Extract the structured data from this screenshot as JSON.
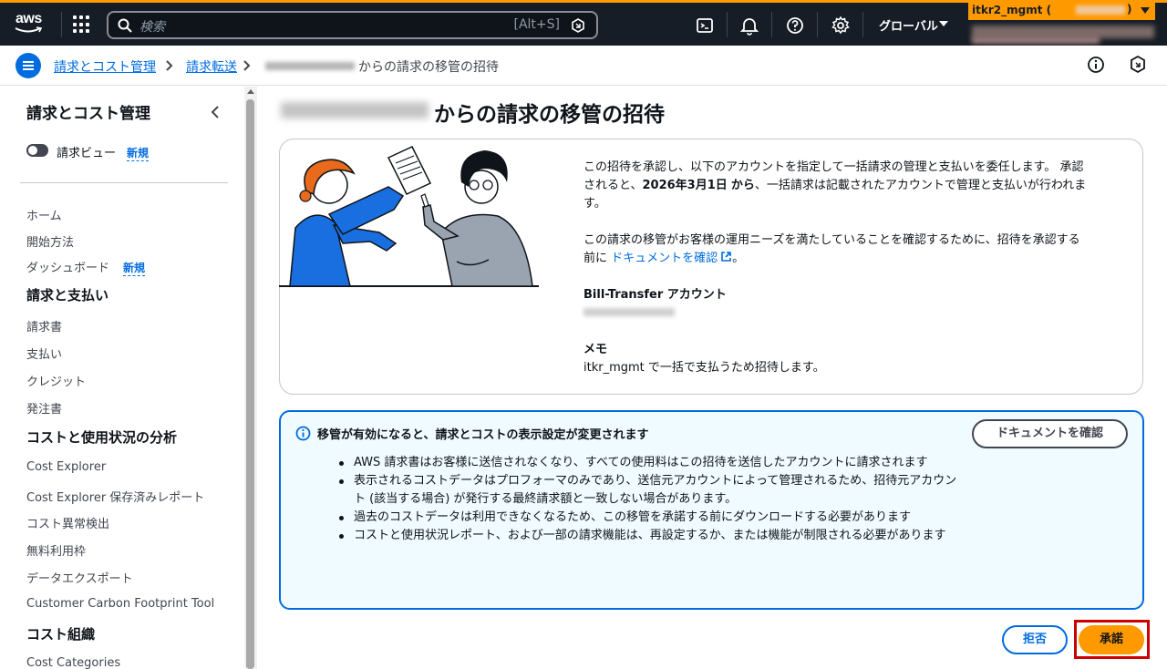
{
  "topbar": {
    "logo_text": "aws",
    "search_placeholder": "検索",
    "search_shortcut": "[Alt+S]",
    "region_label": "グローバル",
    "account_label": "itkr2_mgmt (",
    "account_close": ")"
  },
  "breadcrumb": {
    "items": [
      "請求とコスト管理",
      "請求転送"
    ],
    "current_suffix": "からの請求の移管の招待"
  },
  "sidebar": {
    "title": "請求とコスト管理",
    "billing_view_label": "請求ビュー",
    "new_badge": "新規",
    "items_top": [
      "ホーム",
      "開始方法",
      "ダッシュボード"
    ],
    "sections": [
      {
        "heading": "請求と支払い",
        "items": [
          "請求書",
          "支払い",
          "クレジット",
          "発注書"
        ]
      },
      {
        "heading": "コストと使用状況の分析",
        "items": [
          "Cost Explorer",
          "Cost Explorer 保存済みレポート",
          "コスト異常検出",
          "無料利用枠",
          "データエクスポート",
          "Customer Carbon Footprint Tool"
        ]
      },
      {
        "heading": "コスト組織",
        "items": [
          "Cost Categories"
        ]
      }
    ]
  },
  "main": {
    "title_suffix": "からの請求の移管の招待",
    "intro_line1": "この招待を承認し、以下のアカウントを指定して一括請求の管理と支払いを委任します。 承認",
    "intro_line2_pre": "されると、",
    "intro_date": "2026年3月1日",
    "intro_line2_mid": "から",
    "intro_line2_post": "、一括請求は記載されたアカウントで管理と支払いが行われま",
    "intro_line3": "す。",
    "confirm_line1": "この請求の移管がお客様の運用ニーズを満たしていることを確認するために、招待を承認する",
    "confirm_line2_pre": "前に",
    "confirm_link": "ドキュメントを確認",
    "confirm_line2_post": "。",
    "account_heading": "Bill-Transfer アカウント",
    "memo_heading": "メモ",
    "memo_text": "itkr_mgmt で一括で支払うため招待します。"
  },
  "alert": {
    "title": "移管が有効になると、請求とコストの表示設定が変更されます",
    "doc_button": "ドキュメントを確認",
    "bullets": [
      "AWS 請求書はお客様に送信されなくなり、すべての使用料はこの招待を送信したアカウントに請求されます",
      "表示されるコストデータはプロフォーマのみであり、送信元アカウントによって管理されるため、招待元アカウント (該当する場合) が発行する最終請求額と一致しない場合があります。",
      "過去のコストデータは利用できなくなるため、この移管を承諾する前にダウンロードする必要があります",
      "コストと使用状況レポート、および一部の請求機能は、再設定するか、または機能が制限される必要があります"
    ]
  },
  "actions": {
    "reject_label": "拒否",
    "accept_label": "承諾"
  },
  "colors": {
    "accent": "#ff9900",
    "link": "#006ce0",
    "topbar_bg": "#161d26",
    "highlight": "#cc0000"
  }
}
